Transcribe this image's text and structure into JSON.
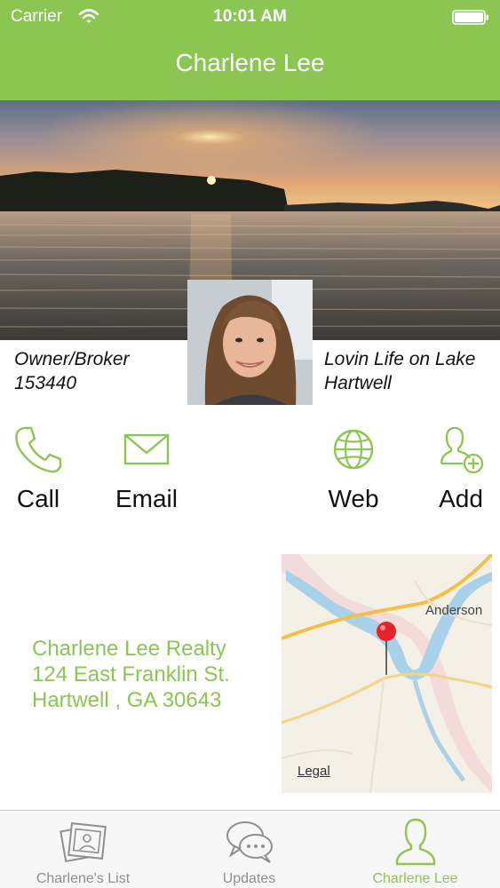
{
  "status_bar": {
    "carrier": "Carrier",
    "time": "10:01 AM"
  },
  "nav": {
    "title": "Charlene Lee"
  },
  "profile": {
    "left_line1": "Owner/Broker",
    "left_line2": "153440",
    "right_line1": "Lovin Life on Lake",
    "right_line2": "Hartwell"
  },
  "actions": [
    {
      "label": "Call",
      "icon": "phone-icon"
    },
    {
      "label": "Email",
      "icon": "envelope-icon"
    },
    {
      "label": "Web",
      "icon": "globe-icon"
    },
    {
      "label": "Add",
      "icon": "add-contact-icon"
    }
  ],
  "address": {
    "line1": "Charlene Lee Realty",
    "line2": "124 East Franklin St.",
    "line3": "Hartwell , GA 30643"
  },
  "map": {
    "city_label": "Anderson",
    "legal": "Legal"
  },
  "tabs": [
    {
      "label": "Charlene's List",
      "icon": "photos-icon",
      "active": false
    },
    {
      "label": "Updates",
      "icon": "chat-bubbles-icon",
      "active": false
    },
    {
      "label": "Charlene Lee",
      "icon": "person-icon",
      "active": true
    }
  ],
  "colors": {
    "accent": "#8cc652",
    "inactive": "#8e8e93"
  }
}
